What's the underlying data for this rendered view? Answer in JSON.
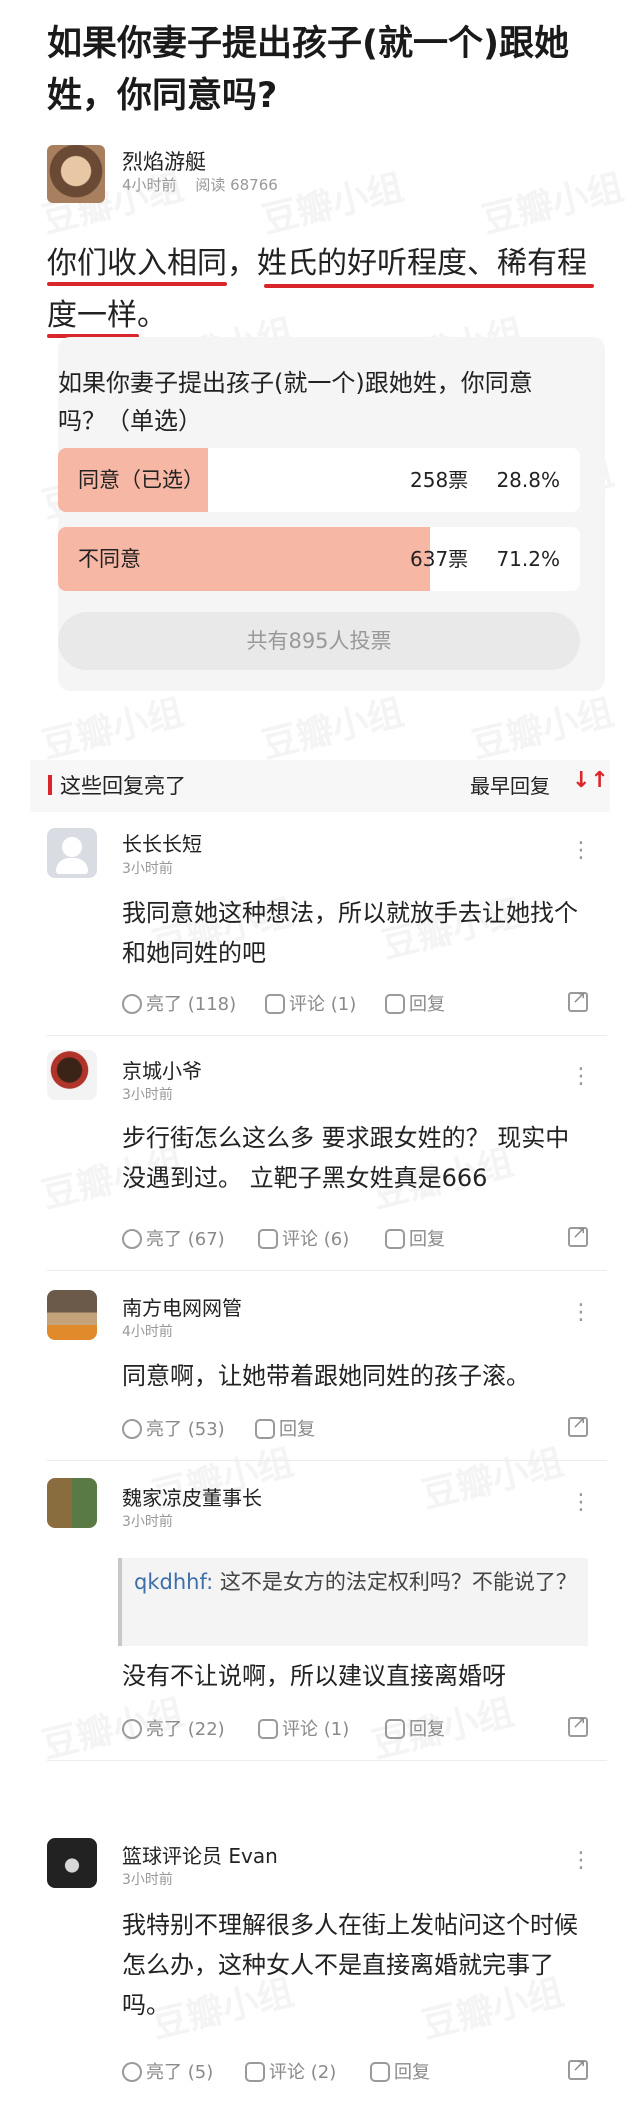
{
  "post": {
    "title": "如果你妻子提出孩子(就一个)跟她姓，你同意吗?",
    "author": {
      "name": "烈焰游艇",
      "time": "4小时前",
      "reads": "阅读 68766"
    },
    "body": "你们收入相同，姓氏的好听程度、稀有程度一样。"
  },
  "poll": {
    "question": "如果你妻子提出孩子(就一个)跟她姓，你同意吗？（单选）",
    "options": [
      {
        "label": "同意（已选）",
        "count": "258票",
        "percent": "28.8%",
        "share": 0.288
      },
      {
        "label": "不同意",
        "count": "637票",
        "percent": "71.2%",
        "share": 0.712
      }
    ],
    "total": "共有895人投票"
  },
  "section": {
    "title": "这些回复亮了",
    "sort": "最早回复",
    "sort_icon": "sort-arrows-icon"
  },
  "comments": [
    {
      "name": "长长长短",
      "time": "3小时前",
      "text": "我同意她这种想法，所以就放手去让她找个和她同姓的吧",
      "likes": "亮了 (118)",
      "comments": "评论 (1)",
      "reply": "回复"
    },
    {
      "name": "京城小爷",
      "time": "3小时前",
      "text": "步行街怎么这么多 要求跟女姓的？  现实中没遇到过。 立靶子黑女姓真是666",
      "likes": "亮了 (67)",
      "comments": "评论 (6)",
      "reply": "回复"
    },
    {
      "name": "南方电网网管",
      "time": "4小时前",
      "text": "同意啊，让她带着跟她同姓的孩子滚。",
      "likes": "亮了 (53)",
      "reply": "回复"
    },
    {
      "name": "魏家凉皮董事长",
      "time": "3小时前",
      "quote_user": "qkdhhf:",
      "quote_text": " 这不是女方的法定权利吗？不能说了？",
      "text": "没有不让说啊，所以建议直接离婚呀",
      "likes": "亮了 (22)",
      "comments": "评论 (1)",
      "reply": "回复"
    },
    {
      "name": "篮球评论员 Evan",
      "time": "3小时前",
      "text": "我特别不理解很多人在街上发帖问这个时候怎么办，这种女人不是直接离婚就完事了吗。",
      "likes": "亮了 (5)",
      "comments": "评论 (2)",
      "reply": "回复"
    }
  ],
  "watermark": "豆瓣小组",
  "colors": {
    "accent": "#d8262b",
    "poll_fill": "#f7b7a5",
    "quote_user": "#3c6fa8"
  }
}
